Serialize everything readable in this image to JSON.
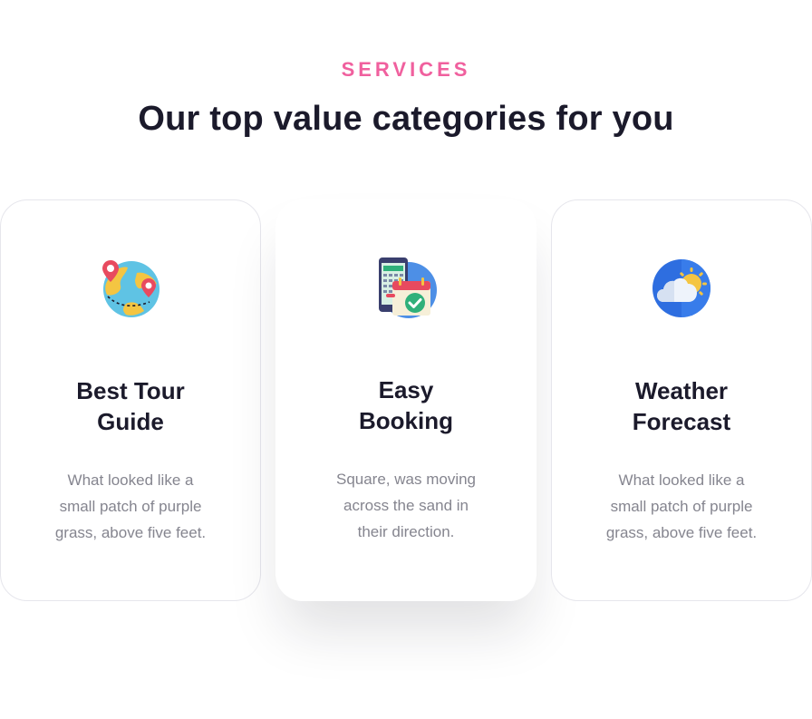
{
  "section": {
    "eyebrow": "SERVICES",
    "heading": "Our top value categories for you"
  },
  "cards": [
    {
      "title": "Best Tour\nGuide",
      "description": "What looked like a small patch of purple grass, above five feet.",
      "icon": "globe-map-pin-icon"
    },
    {
      "title": "Easy\nBooking",
      "description": "Square, was moving across the sand in their direction.",
      "icon": "booking-calendar-icon"
    },
    {
      "title": "Weather\nForecast",
      "description": "What looked like a small patch of purple grass, above five feet.",
      "icon": "cloud-sun-icon"
    }
  ],
  "colors": {
    "accent": "#f0609e",
    "heading": "#1b1a2b",
    "body_text": "#85858f",
    "card_border": "#e6e6ec"
  }
}
